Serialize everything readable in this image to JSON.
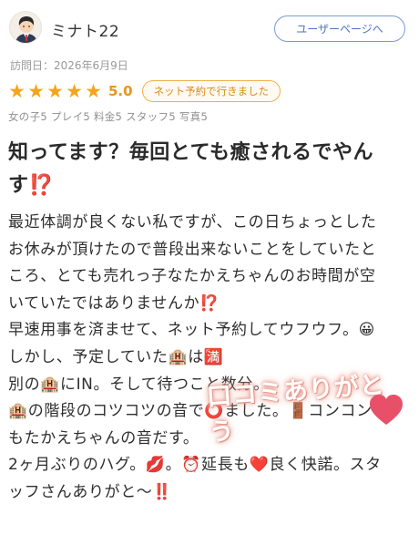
{
  "user": {
    "name": "ミナト22",
    "user_page_button": "ユーザーページへ"
  },
  "visit": {
    "label": "訪問日：2026年6月9日"
  },
  "rating": {
    "score": "5.0",
    "stars": 5,
    "badge": "ネット予約で行きました",
    "sub_scores": "女の子5 プレイ5 料金5 スタッフ5 写真5"
  },
  "review": {
    "title_line1": "知ってます？毎回とても癒されるでやん",
    "title_line2": "す⁉️",
    "lines": [
      "最近体調が良くない私ですが、この日ちょっとした",
      "お休みが頂けたので普段出来ないことをしていたと",
      "ころ、とても売れっ子なたかえちゃんのお時間が空",
      "いていたではありませんか⁉️",
      "早速用事を済ませて、ネット予約してウフウフ。😀",
      "しかし、予定していた🏨は🈵",
      "別の🏨にIN。そして待つこと数分。",
      "🏨の階段のコツコツの音で⭕️ました。🚪コンコン",
      "もたかえちゃんの音だす。",
      "2ヶ月ぶりのハグ。💋。⏰延長も❤️良く快諾。スタ",
      "ッフさんありがと〜‼️"
    ]
  },
  "overlay": {
    "text": "口コミありがとう",
    "heart_color": "#e8506a"
  },
  "colors": {
    "star": "#f5a51b",
    "accent_blue": "#4f73c4",
    "badge_orange": "#d98a1a"
  }
}
